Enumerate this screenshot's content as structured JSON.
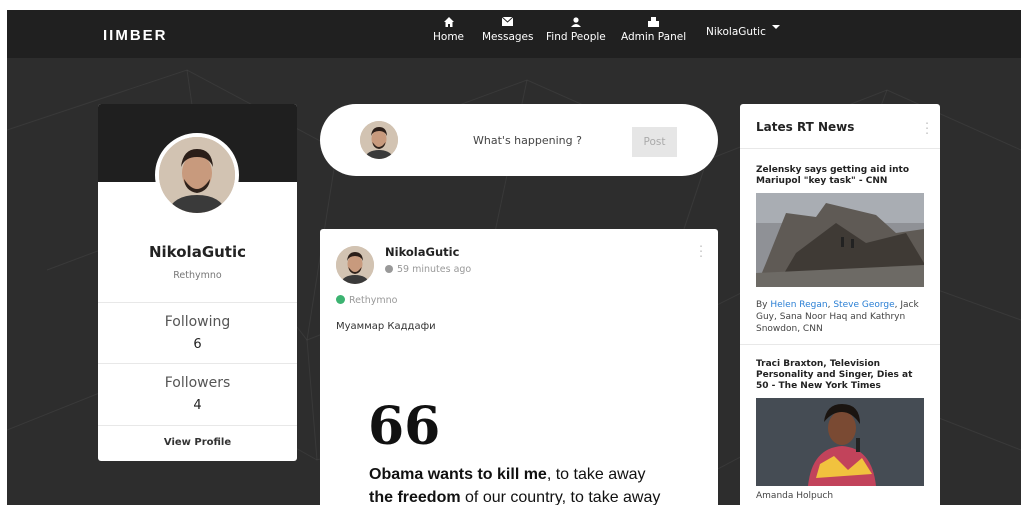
{
  "brand": {
    "logo": "IIMBER"
  },
  "nav": {
    "items": [
      {
        "label": "Home",
        "icon": "home-icon"
      },
      {
        "label": "Messages",
        "icon": "envelope-icon"
      },
      {
        "label": "Find People",
        "icon": "people-icon"
      },
      {
        "label": "Admin Panel",
        "icon": "admin-icon"
      }
    ],
    "user": "NikolaGutic"
  },
  "profile": {
    "name": "NikolaGutic",
    "location": "Rethymno",
    "following_label": "Following",
    "following_count": "6",
    "followers_label": "Followers",
    "followers_count": "4",
    "view_profile": "View Profile"
  },
  "composer": {
    "placeholder": "What's happening ?",
    "post_button": "Post"
  },
  "post": {
    "author": "NikolaGutic",
    "time": "59 minutes ago",
    "location": "Rethymno",
    "text": "Муаммар Каддафи",
    "quote_mark": "66",
    "quote_bold_1": "Obama wants to kill me",
    "quote_normal_1": ", to take away",
    "quote_bold_2": "the freedom",
    "quote_normal_2": " of our country, to take away"
  },
  "news": {
    "title": "Lates RT News",
    "items": [
      {
        "headline": "Zelensky says getting aid into Mariupol \"key task\" - CNN",
        "by": "By ",
        "author_1": "Helen Regan",
        "sep": ", ",
        "author_2": "Steve George",
        "rest": ", Jack Guy, Sana Noor Haq and Kathryn Snowdon, CNN"
      },
      {
        "headline": "Traci Braxton, Television Personality and Singer, Dies at 50 - The New York Times",
        "byline": "Amanda Holpuch"
      }
    ]
  }
}
